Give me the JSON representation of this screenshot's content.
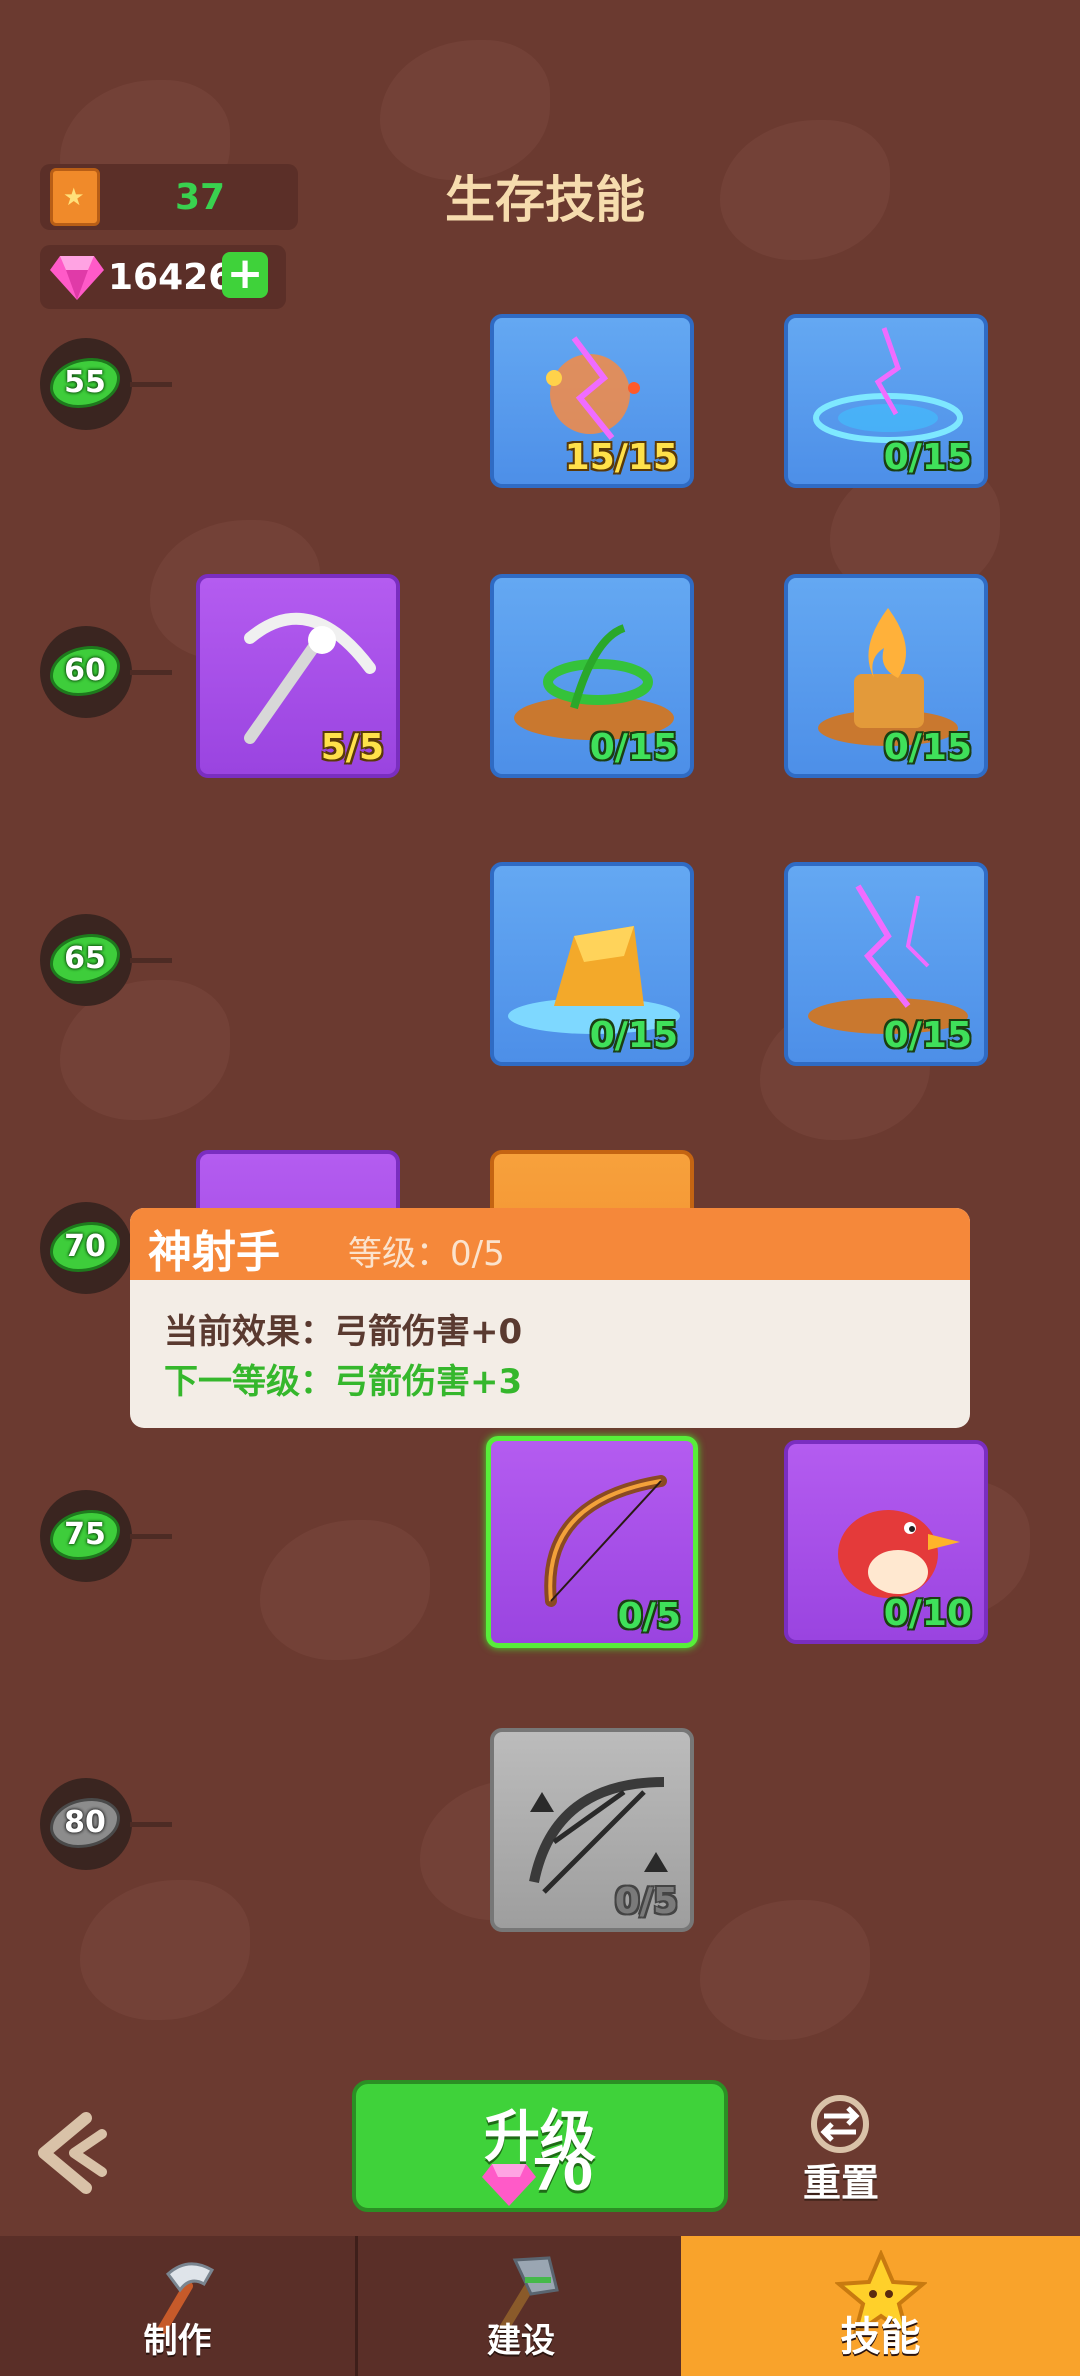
{
  "header": {
    "title": "生存技能",
    "book_count": "37",
    "gems": "16426",
    "icons": {
      "book": "star-book-icon",
      "gem": "pink-gem-icon",
      "add": "plus-icon"
    }
  },
  "levels": [
    "55",
    "60",
    "65",
    "70",
    "75",
    "80"
  ],
  "skills": [
    {
      "row": "55",
      "count": "15/15",
      "color": "blue",
      "icon": "fire-lightning-icon"
    },
    {
      "row": "55",
      "count": "0/15",
      "color": "blue",
      "icon": "lightning-ring-icon"
    },
    {
      "row": "60",
      "count": "5/5",
      "color": "purple",
      "icon": "pickaxe-icon"
    },
    {
      "row": "60",
      "count": "0/15",
      "color": "blue",
      "icon": "vine-icon"
    },
    {
      "row": "60",
      "count": "0/15",
      "color": "blue",
      "icon": "campfire-icon"
    },
    {
      "row": "65",
      "count": "0/15",
      "color": "blue",
      "icon": "water-rock-icon"
    },
    {
      "row": "65",
      "count": "0/15",
      "color": "blue",
      "icon": "lightning-ground-icon"
    },
    {
      "row": "75",
      "count": "0/5",
      "color": "purple",
      "icon": "bow-icon"
    },
    {
      "row": "75",
      "count": "0/10",
      "color": "purple",
      "icon": "red-bird-icon"
    },
    {
      "row": "80",
      "count": "0/5",
      "color": "gray",
      "icon": "multi-bow-icon"
    }
  ],
  "tooltip": {
    "name": "神射手",
    "level": "等级：0/5",
    "current": "当前效果：弓箭伤害+0",
    "next": "下一等级：弓箭伤害+3"
  },
  "actions": {
    "upgrade_label": "升级",
    "upgrade_cost": "70",
    "reset_label": "重置"
  },
  "tabs": [
    {
      "label": "制作",
      "icon": "hammer-icon",
      "active": false
    },
    {
      "label": "建设",
      "icon": "axe-icon",
      "active": false
    },
    {
      "label": "技能",
      "icon": "star-icon",
      "active": true
    }
  ],
  "colors": {
    "background": "#6b3a30",
    "accent_green": "#3fd23a",
    "tooltip_header": "#f5883a",
    "active_tab": "#f9a32b"
  }
}
